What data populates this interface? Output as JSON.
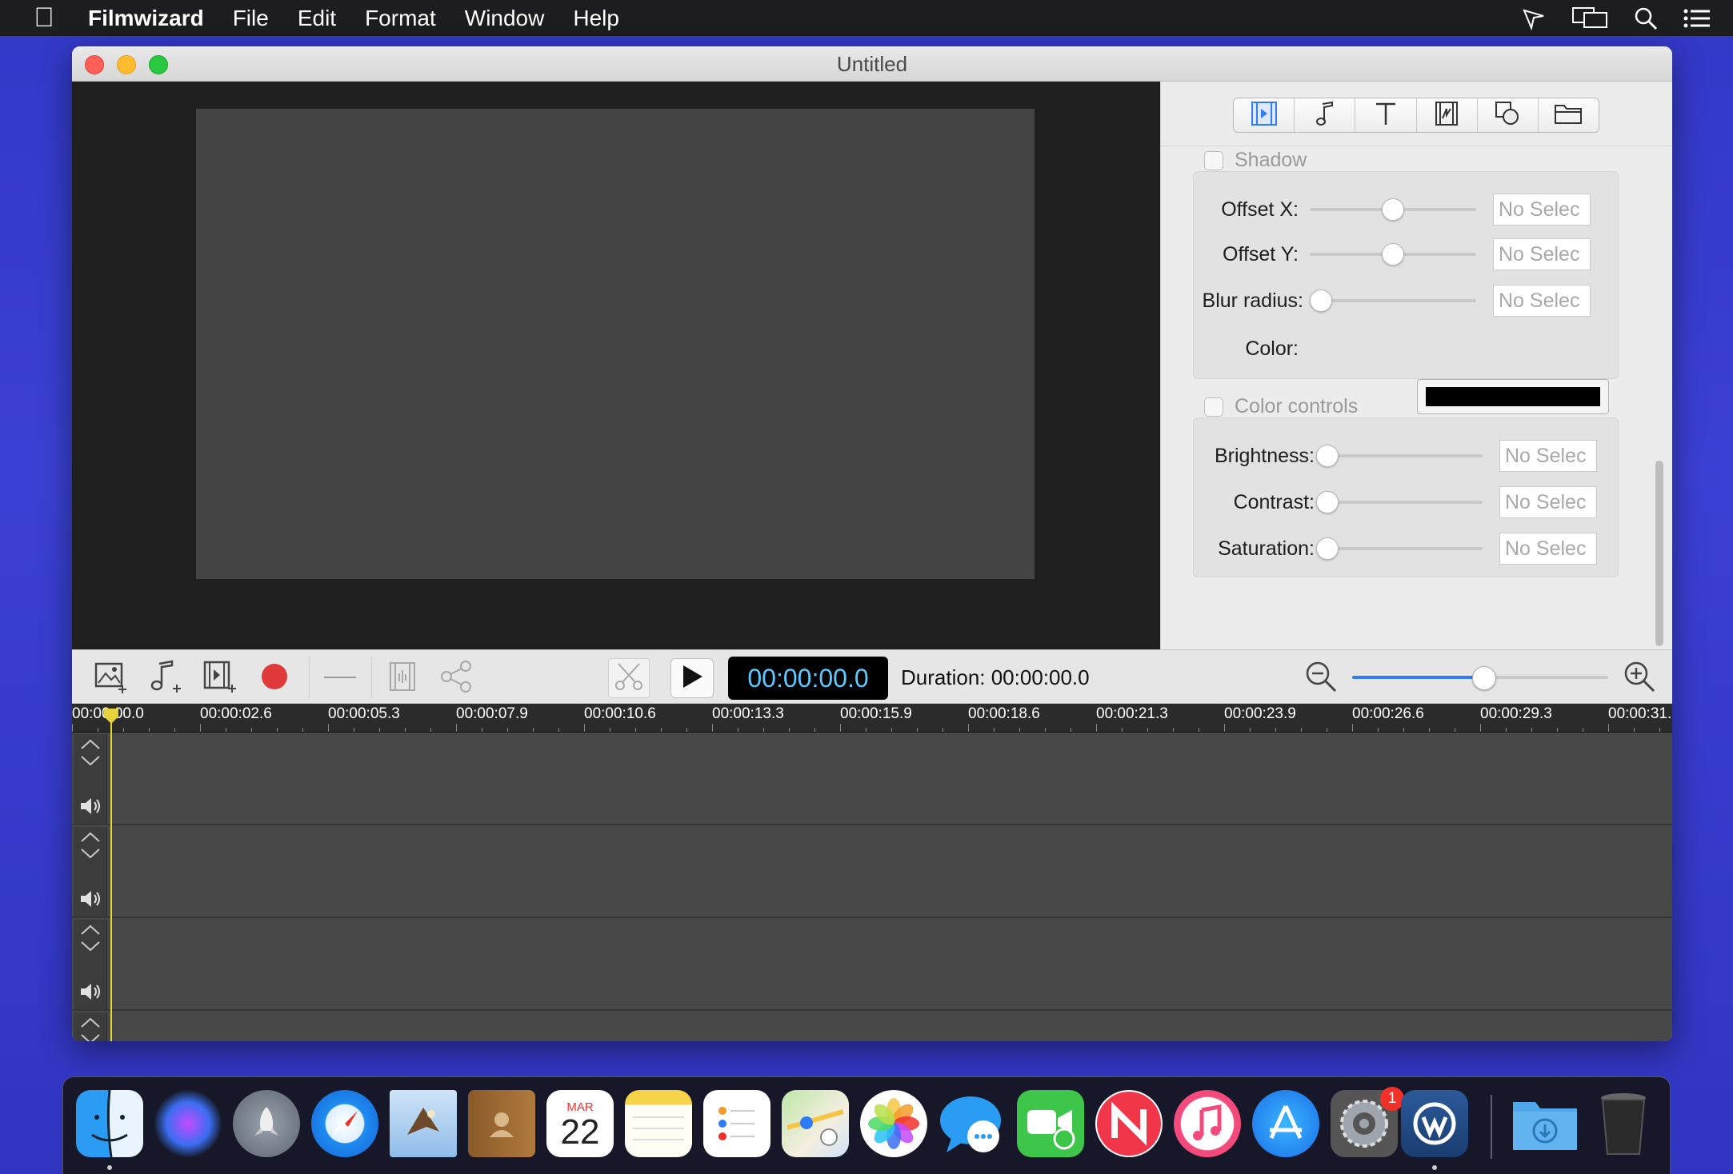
{
  "menubar": {
    "app_name": "Filmwizard",
    "items": [
      "File",
      "Edit",
      "Format",
      "Window",
      "Help"
    ]
  },
  "window": {
    "title": "Untitled"
  },
  "inspector": {
    "tabs": [
      "video-clip",
      "audio",
      "text",
      "transition",
      "shapes",
      "folder"
    ],
    "shadow_section": {
      "label": "Shadow",
      "checked": false,
      "rows": [
        {
          "label": "Offset X:",
          "value": "No Selec",
          "slider": 0.5
        },
        {
          "label": "Offset Y:",
          "value": "No Selec",
          "slider": 0.5
        },
        {
          "label": "Blur radius:",
          "value": "No Selec",
          "slider": 0.0
        }
      ],
      "color_label": "Color:",
      "color_value": "#000000"
    },
    "color_controls_section": {
      "label": "Color controls",
      "checked": false,
      "rows": [
        {
          "label": "Brightness:",
          "value": "No Selec",
          "slider": 0.0
        },
        {
          "label": "Contrast:",
          "value": "No Selec",
          "slider": 0.0
        },
        {
          "label": "Saturation:",
          "value": "No Selec",
          "slider": 0.0
        }
      ]
    }
  },
  "toolbar": {
    "timecode": "00:00:00.0",
    "duration": "Duration: 00:00:00.0",
    "zoom_level": 0.5
  },
  "timeline": {
    "ruler_labels": [
      "00:00:00.0",
      "00:00:02.6",
      "00:00:05.3",
      "00:00:07.9",
      "00:00:10.6",
      "00:00:13.3",
      "00:00:15.9",
      "00:00:18.6",
      "00:00:21.3",
      "00:00:23.9",
      "00:00:26.6",
      "00:00:29.3",
      "00:00:31."
    ],
    "track_count": 4
  },
  "dock": {
    "apps": [
      "Finder",
      "Siri",
      "Launchpad",
      "Safari",
      "Mail",
      "Contacts",
      "Calendar",
      "Notes",
      "Reminders",
      "Maps",
      "Photos",
      "Messages",
      "FaceTime",
      "News",
      "Music",
      "App Store",
      "System Preferences",
      "Filmwizard"
    ],
    "calendar_month": "MAR",
    "calendar_day": "22",
    "system_prefs_badge": "1"
  },
  "colors": {
    "accent": "#2f7cf6",
    "timecode": "#5ec8ff",
    "record": "#e03a3a",
    "playhead": "#e6d23c"
  }
}
